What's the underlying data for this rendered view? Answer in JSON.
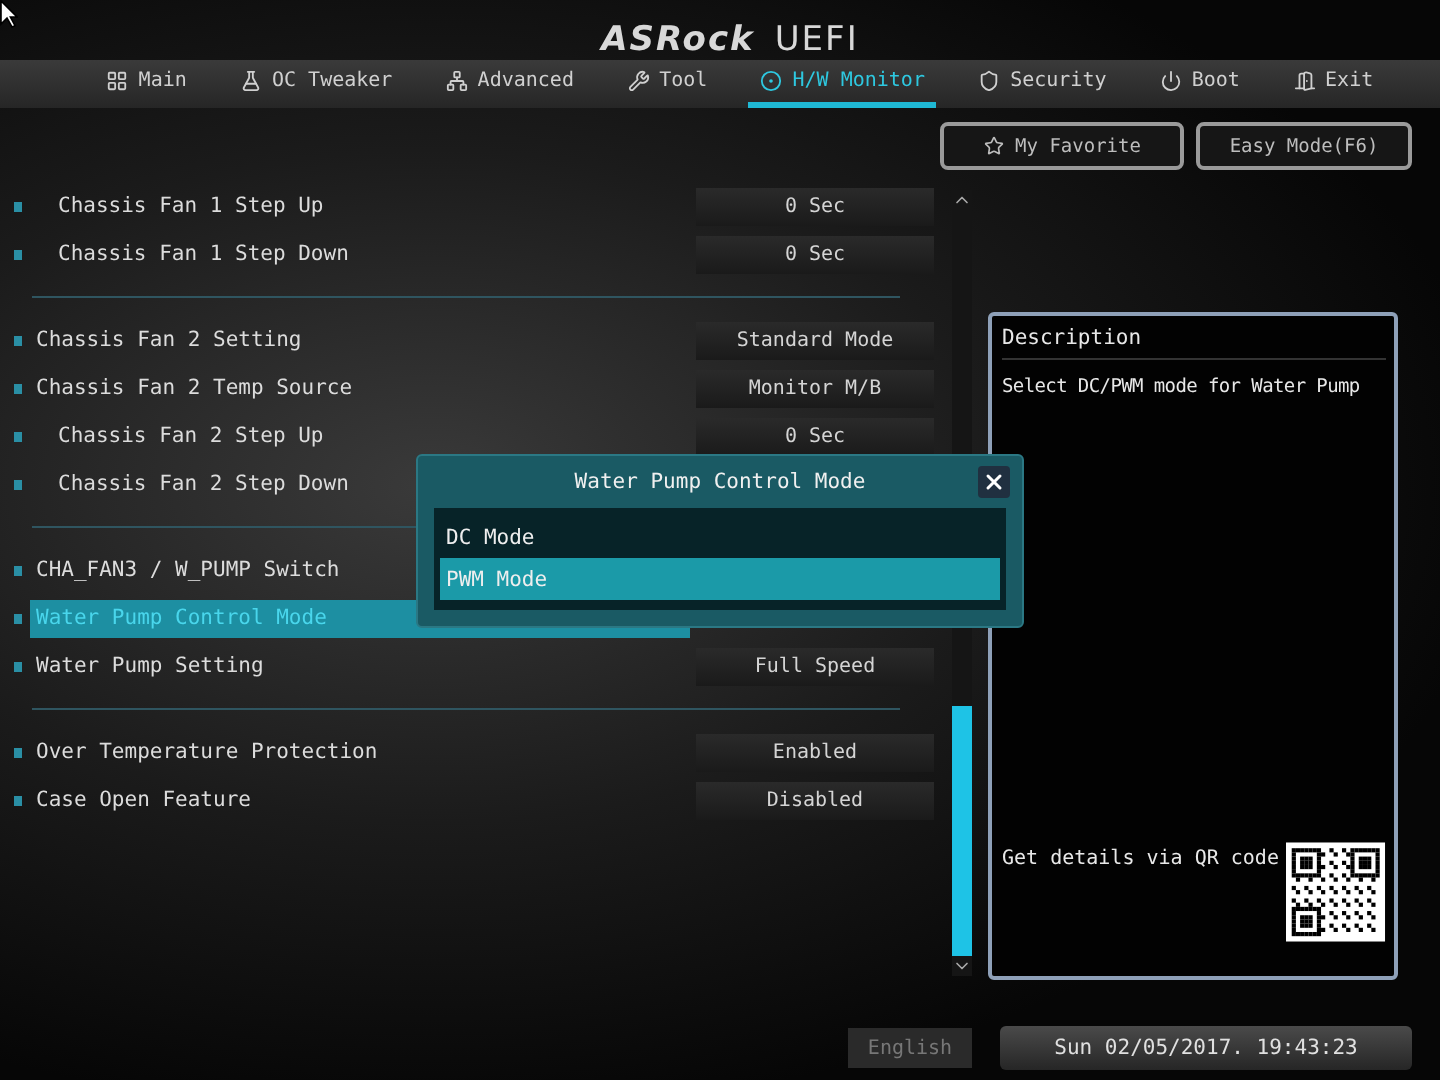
{
  "logo": {
    "brand": "ASRock",
    "product": "UEFI"
  },
  "tabs": [
    {
      "label": "Main",
      "selected": false
    },
    {
      "label": "OC Tweaker",
      "selected": false
    },
    {
      "label": "Advanced",
      "selected": false
    },
    {
      "label": "Tool",
      "selected": false
    },
    {
      "label": "H/W Monitor",
      "selected": true
    },
    {
      "label": "Security",
      "selected": false
    },
    {
      "label": "Boot",
      "selected": false
    },
    {
      "label": "Exit",
      "selected": false
    }
  ],
  "quick_buttons": {
    "my_favorite": "My Favorite",
    "easy_mode": "Easy Mode(F6)"
  },
  "settings": {
    "sections": [
      {
        "children": [
          {
            "label": "Chassis Fan 1 Step Up",
            "value": "0 Sec",
            "selected": false
          },
          {
            "label": "Chassis Fan 1 Step Down",
            "value": "0 Sec",
            "selected": false
          }
        ]
      },
      {
        "items": [
          {
            "label": "Chassis Fan 2 Setting",
            "value": "Standard Mode",
            "selected": false
          },
          {
            "label": "Chassis Fan 2 Temp Source",
            "value": "Monitor M/B",
            "selected": false,
            "children": [
              {
                "label": "Chassis Fan 2 Step Up",
                "value": "0 Sec",
                "selected": false
              },
              {
                "label": "Chassis Fan 2 Step Down",
                "selected": false
              }
            ]
          }
        ]
      },
      {
        "items": [
          {
            "label": "CHA_FAN3 / W_PUMP Switch",
            "selected": false
          },
          {
            "label": "Water Pump Control Mode",
            "selected": true
          },
          {
            "label": "Water Pump Setting",
            "value": "Full Speed",
            "selected": false
          }
        ]
      },
      {
        "items": [
          {
            "label": "Over Temperature Protection",
            "value": "Enabled",
            "selected": false
          },
          {
            "label": "Case Open Feature",
            "value": "Disabled",
            "selected": false
          }
        ]
      }
    ]
  },
  "description": {
    "title": "Description",
    "text": "Select DC/PWM mode for Water Pump",
    "qr_caption": "Get details via QR code"
  },
  "dialog": {
    "title": "Water Pump Control Mode",
    "options": [
      {
        "label": "DC Mode",
        "selected": false
      },
      {
        "label": "PWM Mode",
        "selected": true
      }
    ]
  },
  "footer": {
    "language": "English",
    "datetime": "Sun 02/05/2017. 19:43:23"
  }
}
